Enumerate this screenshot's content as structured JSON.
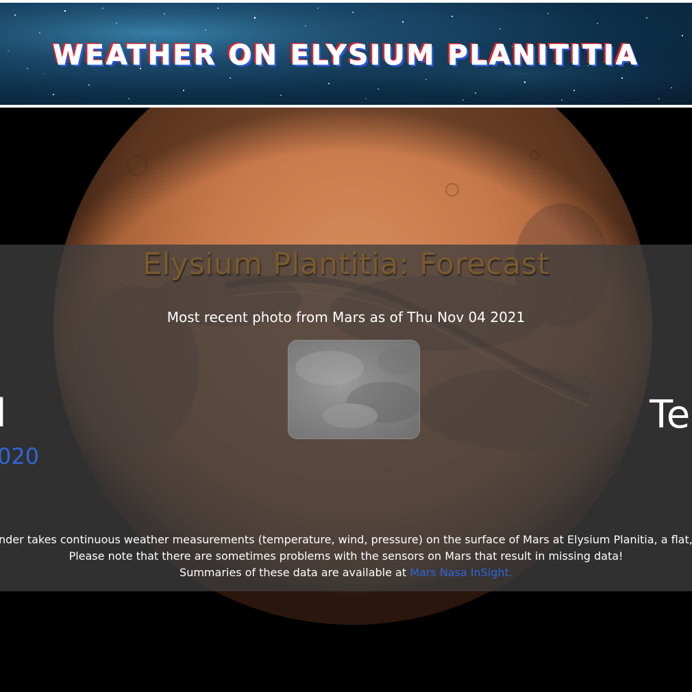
{
  "header": {
    "title": "WEATHER ON ELYSIUM PLANITITIA"
  },
  "forecast": {
    "title": "Elysium Plantitia: Forecast",
    "photo_caption": "Most recent photo from Mars as of Thu Nov 04 2021"
  },
  "side": {
    "left_text": "l",
    "left_date": "020",
    "right_text": "Te"
  },
  "description": {
    "line1": "nder takes continuous weather measurements (temperature, wind, pressure) on the surface of Mars at Elysium Planitia, a flat, smooth",
    "line2": "Please note that there are sometimes problems with the sensors on Mars that result in missing data!",
    "line3_prefix": "Summaries of these data are available at ",
    "line3_link": "Mars Nasa InSight."
  },
  "colors": {
    "panel": "#3e3e3e",
    "link": "#2f66d9",
    "forecast_title": "#7a5a2e",
    "banner_shadow_red": "#e3222a",
    "banner_shadow_blue": "#2b56d6"
  }
}
